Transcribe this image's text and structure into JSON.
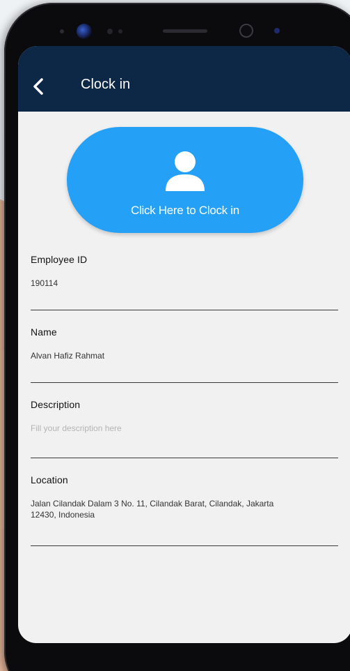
{
  "header": {
    "title": "Clock in"
  },
  "clock_button": {
    "label": "Click Here to Clock in",
    "color": "#24a0f7"
  },
  "fields": {
    "employee_id": {
      "label": "Employee ID",
      "value": "190114"
    },
    "name": {
      "label": "Name",
      "value": "Alvan Hafiz Rahmat"
    },
    "description": {
      "label": "Description",
      "placeholder": "Fill your description here"
    },
    "location": {
      "label": "Location",
      "value": "Jalan Cilandak Dalam 3 No. 11, Cilandak Barat, Cilandak, Jakarta 12430, Indonesia"
    }
  },
  "colors": {
    "header_bg": "#0d2746",
    "screen_bg": "#f1f1f1",
    "accent": "#24a0f7"
  },
  "icons": {
    "back": "chevron-left-icon",
    "clock_in": "person-icon"
  }
}
